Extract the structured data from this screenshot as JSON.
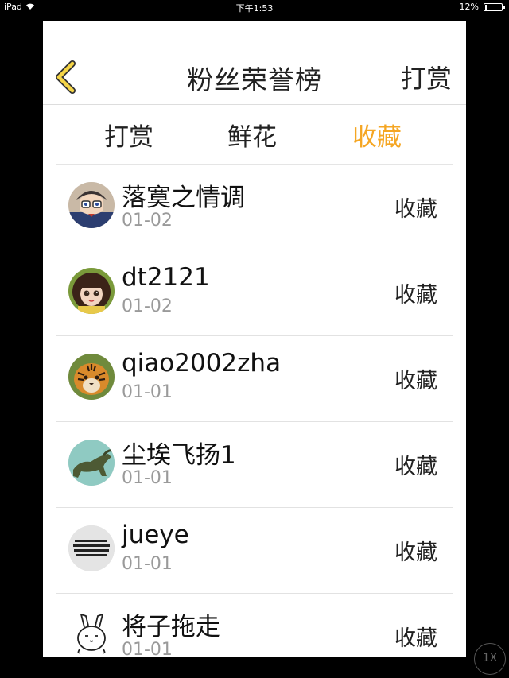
{
  "status_bar": {
    "device": "iPad",
    "time": "下午1:53",
    "battery_percent": "12%",
    "battery_level": 0.12
  },
  "navbar": {
    "title": "粉丝荣誉榜",
    "right_label": "打赏",
    "back_icon": "chevron-left-icon",
    "accent_color": "#f5a623"
  },
  "tabs": [
    {
      "label": "打赏",
      "active": false
    },
    {
      "label": "鲜花",
      "active": false
    },
    {
      "label": "收藏",
      "active": true
    }
  ],
  "fans": [
    {
      "name": "落寞之情调",
      "date": "01-02",
      "action": "收藏",
      "avatar": "anime-boy-avatar"
    },
    {
      "name": "dt2121",
      "date": "01-02",
      "action": "收藏",
      "avatar": "doll-avatar"
    },
    {
      "name": "qiao2002zha",
      "date": "01-01",
      "action": "收藏",
      "avatar": "tiger-avatar"
    },
    {
      "name": "尘埃飞扬1",
      "date": "01-01",
      "action": "收藏",
      "avatar": "bronze-bull-avatar"
    },
    {
      "name": "jueye",
      "date": "01-01",
      "action": "收藏",
      "avatar": "text-image-avatar"
    },
    {
      "name": "将子拖走",
      "date": "01-01",
      "action": "收藏",
      "avatar": "rabbit-avatar"
    }
  ],
  "zoom_button": {
    "label": "1X"
  }
}
